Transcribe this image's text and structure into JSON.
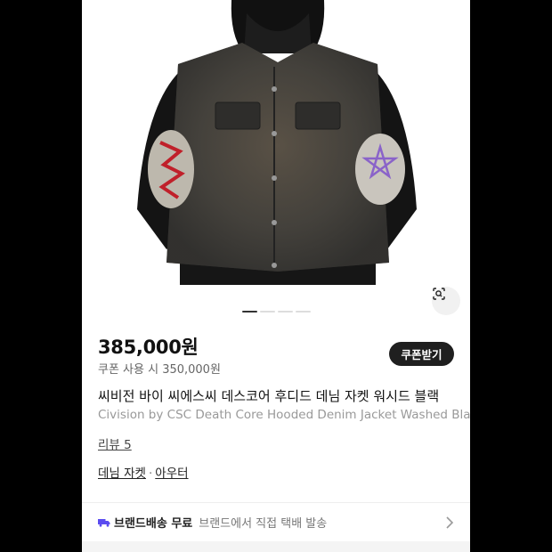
{
  "product": {
    "price": "385,000원",
    "coupon_price": "쿠폰 사용 시 350,000원",
    "coupon_button": "쿠폰받기",
    "title_ko": "씨비전 바이 씨에스씨 데스코어 후디드 데님 자켓 워시드 블랙",
    "title_en": "Civision by CSC Death Core Hooded Denim Jacket Washed Black",
    "reviews": "리뷰 5",
    "category_1": "데님 자켓",
    "category_sep": "·",
    "category_2": "아우터"
  },
  "gallery": {
    "image_icon": "jacket-image",
    "lens_icon": "lens-search-icon",
    "page_count": 4,
    "active_page": 1
  },
  "shipping": {
    "icon": "truck-icon",
    "title": "브랜드배송 무료",
    "detail": "브랜드에서 직접 택배 발송"
  },
  "colors": {
    "accent": "#5b4cf0",
    "button_bg": "#1f1f1f"
  }
}
